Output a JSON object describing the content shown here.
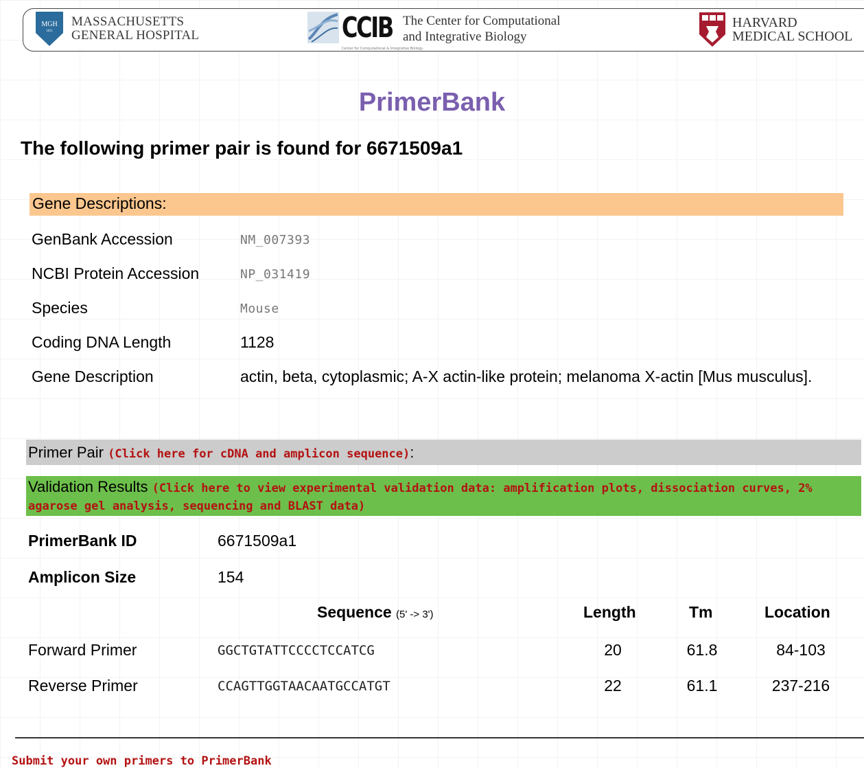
{
  "header": {
    "mgh_logo_text": "MGH",
    "mgh_logo_year": "1811",
    "mgh_line1": "MASSACHUSETTS",
    "mgh_line2": "GENERAL HOSPITAL",
    "ccib_logo": "CCIB",
    "ccib_tagline": "Center for Computational & Integrative Biology",
    "ccib_line1": "The Center for Computational",
    "ccib_line2": "and Integrative Biology",
    "hms_line1": "HARVARD",
    "hms_line2": "MEDICAL SCHOOL"
  },
  "page_title": "PrimerBank",
  "found_heading": "The following primer pair is found for 6671509a1",
  "gene_section": {
    "header": "Gene Descriptions:",
    "rows": [
      {
        "label": "GenBank Accession",
        "value": "NM_007393"
      },
      {
        "label": "NCBI Protein Accession",
        "value": "NP_031419"
      },
      {
        "label": "Species",
        "value": "Mouse"
      },
      {
        "label": "Coding DNA Length",
        "value": "1128"
      },
      {
        "label": "Gene Description",
        "value": "actin, beta, cytoplasmic; A-X actin-like protein; melanoma X-actin [Mus musculus]."
      }
    ]
  },
  "primer_pair": {
    "label": "Primer Pair",
    "link": "(Click here for cDNA and amplicon sequence)",
    "colon": ":"
  },
  "validation": {
    "label": "Validation Results",
    "link": "(Click here to view experimental validation data: amplification plots, dissociation curves, 2% agarose gel analysis, sequencing and BLAST data)"
  },
  "primer_info": {
    "id_label": "PrimerBank ID",
    "id_value": "6671509a1",
    "amplicon_label": "Amplicon Size",
    "amplicon_value": "154"
  },
  "primer_table": {
    "headers": {
      "sequence": "Sequence",
      "direction": "(5' -> 3')",
      "length": "Length",
      "tm": "Tm",
      "location": "Location"
    },
    "rows": [
      {
        "name": "Forward Primer",
        "sequence": "GGCTGTATTCCCCTCCATCG",
        "length": "20",
        "tm": "61.8",
        "location": "84-103"
      },
      {
        "name": "Reverse Primer",
        "sequence": "CCAGTTGGTAACAATGCCATGT",
        "length": "22",
        "tm": "61.1",
        "location": "237-216"
      }
    ]
  },
  "footer_link": "Submit your own primers to PrimerBank",
  "colors": {
    "title": "#7a5fae",
    "gene_header_bg": "#fbc78f",
    "primer_pair_bg": "#cccccc",
    "validation_bg": "#6dbf4b",
    "link_red": "#b31212"
  }
}
